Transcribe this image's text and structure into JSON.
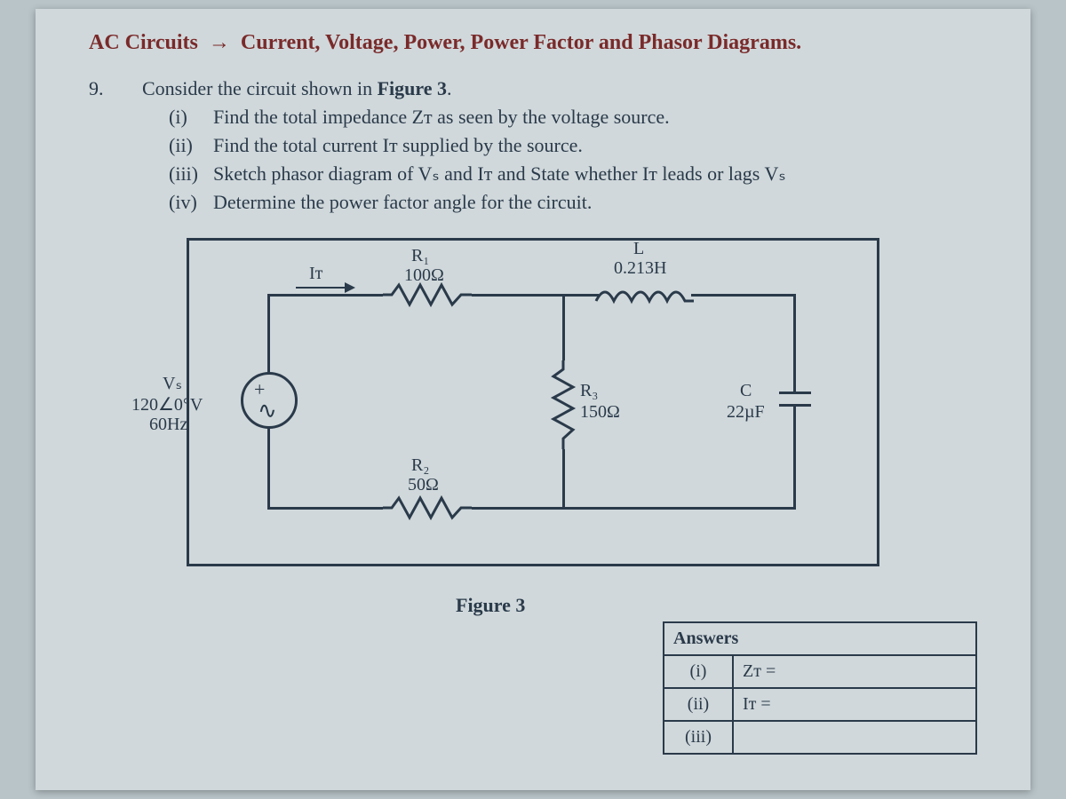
{
  "header": {
    "topic": "AC Circuits",
    "arrow": "→",
    "subtitle": "Current, Voltage, Power, Power Factor and Phasor Diagrams."
  },
  "question": {
    "number": "9.",
    "stem_a": "Consider the circuit shown in ",
    "stem_b": "Figure 3",
    "stem_c": ".",
    "parts": {
      "i": {
        "num": "(i)",
        "text": "Find the total impedance Zᴛ as seen by the voltage source."
      },
      "ii": {
        "num": "(ii)",
        "text": "Find the total current Iᴛ supplied by the source."
      },
      "iii": {
        "num": "(iii)",
        "text": "Sketch phasor diagram of Vₛ and Iᴛ and State whether Iᴛ leads or lags Vₛ"
      },
      "iv": {
        "num": "(iv)",
        "text": "Determine the power factor angle for the circuit."
      }
    }
  },
  "circuit": {
    "caption": "Figure 3",
    "IT": "Iᴛ",
    "source": {
      "name": "Vₛ",
      "value": "120∠0°V",
      "freq": "60Hz"
    },
    "R1": {
      "name": "R₁",
      "value": "100Ω"
    },
    "R2": {
      "name": "R₂",
      "value": "50Ω"
    },
    "R3": {
      "name": "R₃",
      "value": "150Ω"
    },
    "L": {
      "name": "L",
      "value": "0.213H"
    },
    "C": {
      "name": "C",
      "value": "22µF"
    }
  },
  "answers": {
    "title": "Answers",
    "rows": {
      "i": {
        "num": "(i)",
        "val": "Zᴛ ="
      },
      "ii": {
        "num": "(ii)",
        "val": "Iᴛ ="
      },
      "iii": {
        "num": "(iii)",
        "val": ""
      }
    }
  }
}
